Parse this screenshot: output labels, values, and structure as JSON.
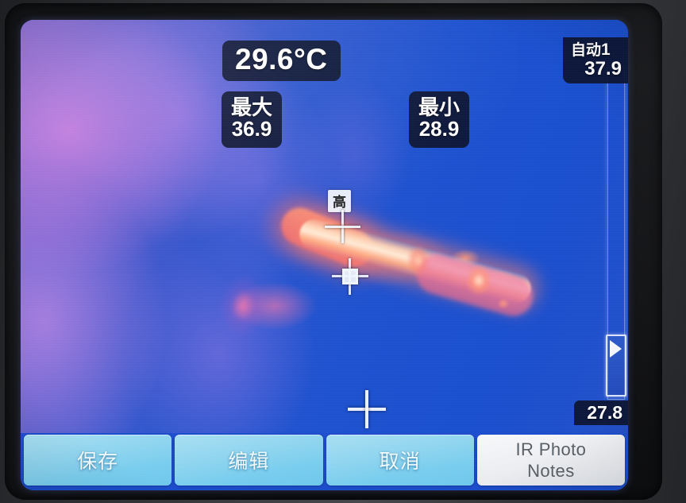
{
  "display": {
    "center_temperature": "29.6°C",
    "max_label": "最大",
    "max_value": "36.9",
    "min_label": "最小",
    "min_value": "28.9",
    "spot_high_label": "高",
    "mode_label": "自动",
    "mode_index": "1",
    "scale_high": "37.9",
    "scale_low": "27.8"
  },
  "buttons": {
    "save": "保存",
    "edit": "编辑",
    "cancel": "取消",
    "ir_notes_line1": "IR Photo",
    "ir_notes_line2": "Notes"
  },
  "colors": {
    "osd_background": "#0c1430",
    "osd_text": "#ffffff",
    "button_cyan": "#8ed4ef",
    "button_light": "#eceef2",
    "cold": "#1f52cf",
    "hot": "#ffffff",
    "bezel": "#141517"
  }
}
